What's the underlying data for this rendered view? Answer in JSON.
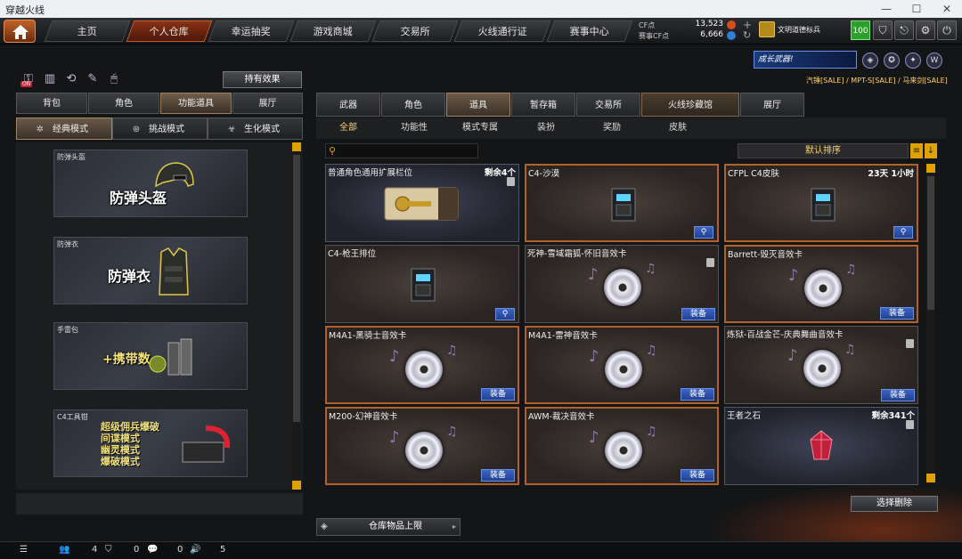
{
  "window": {
    "title": "穿越火线"
  },
  "nav": {
    "tabs": [
      "主页",
      "个人仓库",
      "幸运抽奖",
      "游戏商城",
      "交易所",
      "火线通行证",
      "赛事中心"
    ],
    "active_index": 1
  },
  "currency": {
    "cf_label": "CF点",
    "cf_value": "13,523",
    "match_cf_label": "赛事CF点",
    "match_cf_value": "6,666"
  },
  "player": {
    "rank_name": "文明道德标兵",
    "level": "100"
  },
  "promo": {
    "banner_text": "成长武器!",
    "sale_text": "汽锤[SALE] / MPT-S[SALE] / 马来剑[SALE]"
  },
  "left": {
    "effects_button": "持有效果",
    "toggle_badge": "ON",
    "category_tabs": [
      "背包",
      "角色",
      "功能道具",
      "展厅"
    ],
    "category_active": 2,
    "mode_tabs": [
      "经典模式",
      "挑战模式",
      "生化模式"
    ],
    "mode_active": 0,
    "items": [
      {
        "caption": "防弹头盔",
        "title": "防弹头盔"
      },
      {
        "caption": "防弹衣",
        "title": "防弹衣"
      },
      {
        "caption": "手雷包",
        "title": "+携带数"
      },
      {
        "caption": "C4工具钳",
        "lines": [
          "超级佣兵爆破",
          "间谍模式",
          "幽灵模式",
          "爆破模式"
        ]
      }
    ]
  },
  "right": {
    "tabs": [
      "武器",
      "角色",
      "道具",
      "暂存箱",
      "交易所",
      "火线珍藏馆",
      "展厅"
    ],
    "tab_active": 2,
    "subtabs": [
      "全部",
      "功能性",
      "模式专属",
      "装扮",
      "奖励",
      "皮肤"
    ],
    "subtab_active": 0,
    "search_placeholder": "",
    "sort_label": "默认排序",
    "equip_label": "装备",
    "cards": [
      {
        "name": "普通角色通用扩展栏位",
        "info": "剩余4个",
        "art": "ticket",
        "style": "blue",
        "trash": true
      },
      {
        "name": "C4-沙漠",
        "info": "",
        "art": "c4",
        "style": "gold",
        "zoom": true
      },
      {
        "name": "CFPL C4皮肤",
        "info": "23天 1小时",
        "art": "c4",
        "style": "gold",
        "zoom": true
      },
      {
        "name": "C4-枪王排位",
        "info": "",
        "art": "c4",
        "style": "plain",
        "zoom": true
      },
      {
        "name": "死神-雪域霜狐-怀旧音效卡",
        "info": "",
        "art": "disc",
        "style": "plain",
        "trash": true,
        "equip": true
      },
      {
        "name": "Barrett-毁灭音效卡",
        "info": "",
        "art": "disc",
        "style": "gold",
        "equip": true
      },
      {
        "name": "M4A1-黑骑士音效卡",
        "info": "",
        "art": "disc",
        "style": "gold",
        "equip": true
      },
      {
        "name": "M4A1-雷神音效卡",
        "info": "",
        "art": "disc",
        "style": "gold",
        "equip": true
      },
      {
        "name": "炼狱-百战金芒-庆典舞曲音效卡",
        "info": "",
        "art": "disc",
        "style": "plain",
        "trash": true,
        "equip": true
      },
      {
        "name": "M200-幻神音效卡",
        "info": "",
        "art": "disc",
        "style": "gold",
        "equip": true
      },
      {
        "name": "AWM-裁决音效卡",
        "info": "",
        "art": "disc",
        "style": "gold",
        "equip": true
      },
      {
        "name": "王者之石",
        "info": "剩余341个",
        "art": "gem",
        "style": "blue",
        "trash": true
      }
    ],
    "select_delete": "选择删除",
    "storage_limit": "仓库物品上限"
  },
  "status": {
    "friends": "4",
    "messages": "0",
    "chat": "0",
    "volume": "5"
  },
  "colors": {
    "accent": "#e0a200",
    "active_tab": "#8a3216",
    "equip_button": "#3c64c8"
  }
}
